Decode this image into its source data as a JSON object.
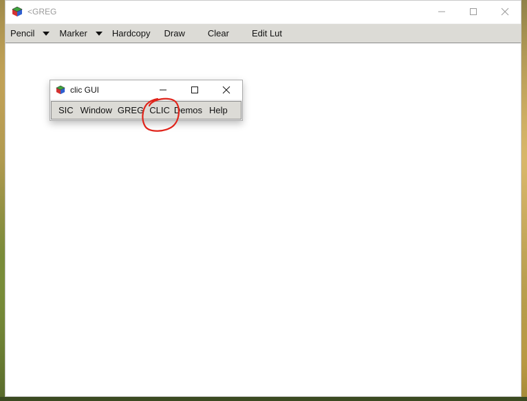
{
  "main_window": {
    "title": "<GREG",
    "menu": [
      {
        "label": "Pencil",
        "has_dropdown": true
      },
      {
        "label": "Marker",
        "has_dropdown": true
      },
      {
        "label": "Hardcopy",
        "has_dropdown": false
      },
      {
        "label": "Draw",
        "has_dropdown": false
      },
      {
        "label": "Clear",
        "has_dropdown": false
      },
      {
        "label": "Edit Lut",
        "has_dropdown": false
      }
    ],
    "controls": [
      "minimize-icon",
      "maximize-icon",
      "close-icon"
    ]
  },
  "clic_window": {
    "title": "clic GUI",
    "menu": [
      "SIC",
      "Window",
      "GREG",
      "CLIC",
      "Demos",
      "Help"
    ],
    "controls": [
      "minimize-icon",
      "maximize-icon",
      "close-icon"
    ]
  },
  "annotation": {
    "color": "#e0231a",
    "target": "CLIC"
  },
  "colors": {
    "menubar": "#dcdbd6",
    "title_inactive": "#9a9a9a"
  }
}
